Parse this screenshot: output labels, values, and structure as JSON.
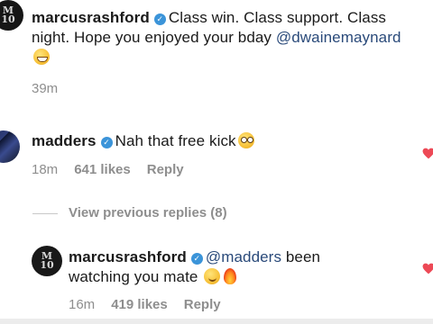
{
  "post_comment": {
    "username": "marcusrashford",
    "text_line1": "Class win. Class support. Class",
    "text_line2_prefix": "night. Hope you enjoyed your bday ",
    "mention": "@dwainemaynard",
    "time": "39m"
  },
  "comment_madders": {
    "username": "madders",
    "text": "Nah that free kick",
    "time": "18m",
    "likes": "641 likes",
    "reply": "Reply"
  },
  "view_previous_replies": "View previous replies (8)",
  "reply_marcus": {
    "username": "marcusrashford",
    "mention": "@madders",
    "text_rest": " been",
    "text_line2": "watching you mate",
    "time": "16m",
    "likes": "419 likes",
    "reply": "Reply"
  },
  "colors": {
    "verified": "#3b94d9",
    "heart": "#ed4956",
    "muted": "#8e8e8e"
  },
  "icons": [
    "verified-badge-icon",
    "heart-icon",
    "grinning-emoji-icon",
    "flushed-emoji-icon",
    "smirk-emoji-icon",
    "fire-emoji-icon"
  ]
}
